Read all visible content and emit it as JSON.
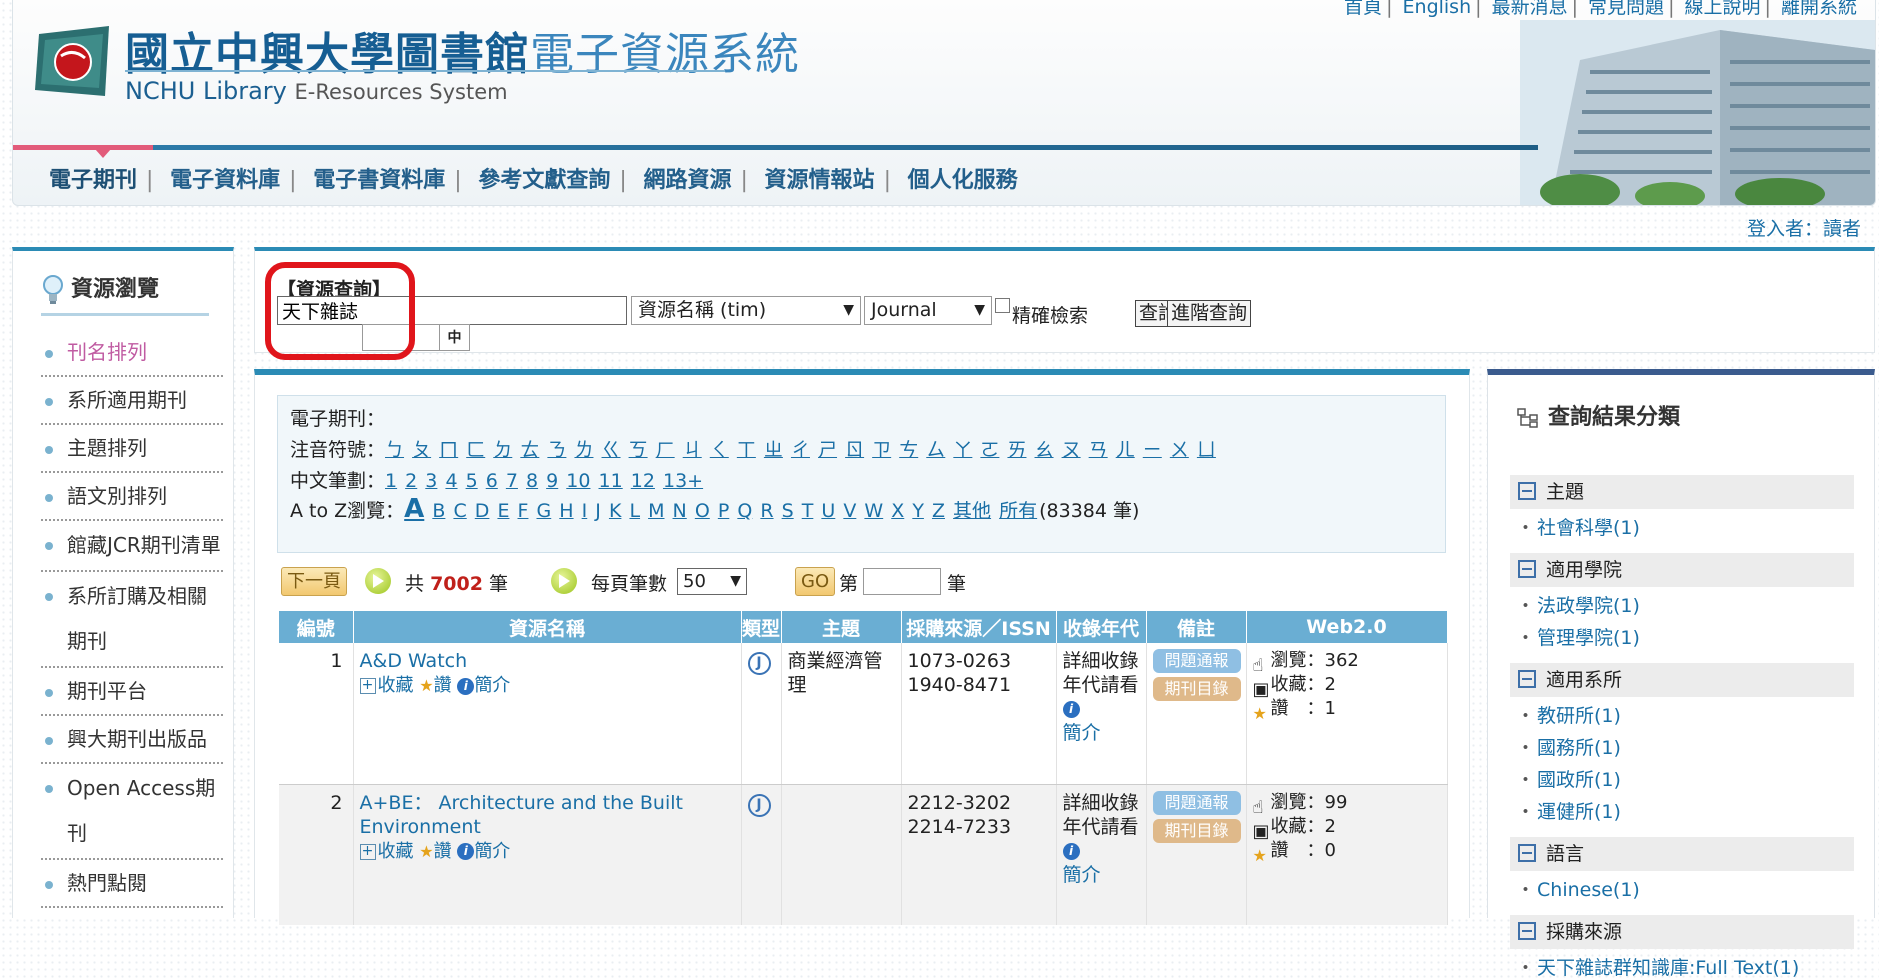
{
  "header": {
    "logo_zh_main": "國立中興大學圖書館",
    "logo_zh_sub": "電子資源系統",
    "logo_en_main": "NCHU Library",
    "logo_en_sub": "E-Resources System",
    "top_links": [
      "首頁",
      "English",
      "最新消息",
      "常見問題",
      "線上說明",
      "離開系統"
    ],
    "nav": [
      "電子期刊",
      "電子資料庫",
      "電子書資料庫",
      "參考文獻查詢",
      "網路資源",
      "資源情報站",
      "個人化服務"
    ],
    "login": "登入者：讀者"
  },
  "sidebar": {
    "title": "資源瀏覽",
    "items": [
      "刊名排列",
      "系所適用期刊",
      "主題排列",
      "語文別排列",
      "館藏JCR期刊清單",
      "系所訂購及相關期刊",
      "期刊平台",
      "興大期刊出版品",
      "Open Access期刊",
      "熱門點閱"
    ]
  },
  "search": {
    "title": "【資源查詢】",
    "query": "天下雜誌",
    "ime": "中",
    "field_select": "資源名稱 (tim)",
    "type_select": "Journal",
    "exact_label": "精確檢索",
    "search_button": "查詢",
    "advanced_button": "進階查詢"
  },
  "browse": {
    "label": "電子期刊：",
    "zhuyin_label": "注音符號：",
    "zhuyin": [
      "ㄅ",
      "ㄆ",
      "ㄇ",
      "ㄈ",
      "ㄉ",
      "ㄊ",
      "ㄋ",
      "ㄌ",
      "ㄍ",
      "ㄎ",
      "ㄏ",
      "ㄐ",
      "ㄑ",
      "ㄒ",
      "ㄓ",
      "ㄔ",
      "ㄕ",
      "ㄖ",
      "ㄗ",
      "ㄘ",
      "ㄙ",
      "ㄚ",
      "ㄛ",
      "ㄞ",
      "ㄠ",
      "ㄡ",
      "ㄢ",
      "ㄦ",
      "ㄧ",
      "ㄨ",
      "ㄩ"
    ],
    "stroke_label": "中文筆劃：",
    "strokes": [
      "1",
      "2",
      "3",
      "4",
      "5",
      "6",
      "7",
      "8",
      "9",
      "10",
      "11",
      "12",
      "13+"
    ],
    "az_label": "A to Z瀏覽：",
    "az_current": "A",
    "az": [
      "B",
      "C",
      "D",
      "E",
      "F",
      "G",
      "H",
      "I",
      "J",
      "K",
      "L",
      "M",
      "N",
      "O",
      "P",
      "Q",
      "R",
      "S",
      "T",
      "U",
      "V",
      "W",
      "X",
      "Y",
      "Z"
    ],
    "other": "其他",
    "all": "所有",
    "all_count": "(83384 筆)"
  },
  "pager": {
    "next": "下一頁",
    "total_prefix": "共",
    "total": "7002",
    "total_suffix": "筆",
    "per_page_label": "每頁筆數",
    "per_page": "50",
    "go": "GO",
    "page_prefix": "第",
    "page_suffix": "筆"
  },
  "table": {
    "headers": [
      "編號",
      "資源名稱",
      "類型",
      "主題",
      "採購來源／ISSN",
      "收錄年代",
      "備註",
      "Web2.0"
    ],
    "rows": [
      {
        "num": "1",
        "title": "A&D Watch",
        "collect": "收藏",
        "like": "讚",
        "intro": "簡介",
        "type": "J",
        "subject": "商業經濟管理",
        "issn1": "1073-0263",
        "issn2": "1940-8471",
        "coverage": "詳細收錄年代請看",
        "coverage_link": "簡介",
        "badge1": "問題通報",
        "badge2": "期刊目錄",
        "views": "瀏覽：362",
        "collects": "收藏：2",
        "likes": "讚　：1"
      },
      {
        "num": "2",
        "title": "A+BE： Architecture and the Built Environment",
        "collect": "收藏",
        "like": "讚",
        "intro": "簡介",
        "type": "J",
        "subject": "",
        "issn1": "2212-3202",
        "issn2": "2214-7233",
        "coverage": "詳細收錄年代請看",
        "coverage_link": "簡介",
        "badge1": "問題通報",
        "badge2": "期刊目錄",
        "views": "瀏覽：99",
        "collects": "收藏：2",
        "likes": "讚　：0"
      }
    ]
  },
  "facets": {
    "title": "查詢結果分類",
    "groups": [
      {
        "name": "主題",
        "items": [
          "社會科學(1)"
        ]
      },
      {
        "name": "適用學院",
        "items": [
          "法政學院(1)",
          "管理學院(1)"
        ]
      },
      {
        "name": "適用系所",
        "items": [
          "教研所(1)",
          "國務所(1)",
          "國政所(1)",
          "運健所(1)"
        ]
      },
      {
        "name": "語言",
        "items": [
          "Chinese(1)"
        ]
      },
      {
        "name": "採購來源",
        "items": [
          "天下雜誌群知識庫:Full Text(1)"
        ]
      }
    ]
  },
  "colors": {
    "accent": "#2b8bb5",
    "highlight_ring": "#e0151b",
    "header_blue": "#6aaed3"
  }
}
